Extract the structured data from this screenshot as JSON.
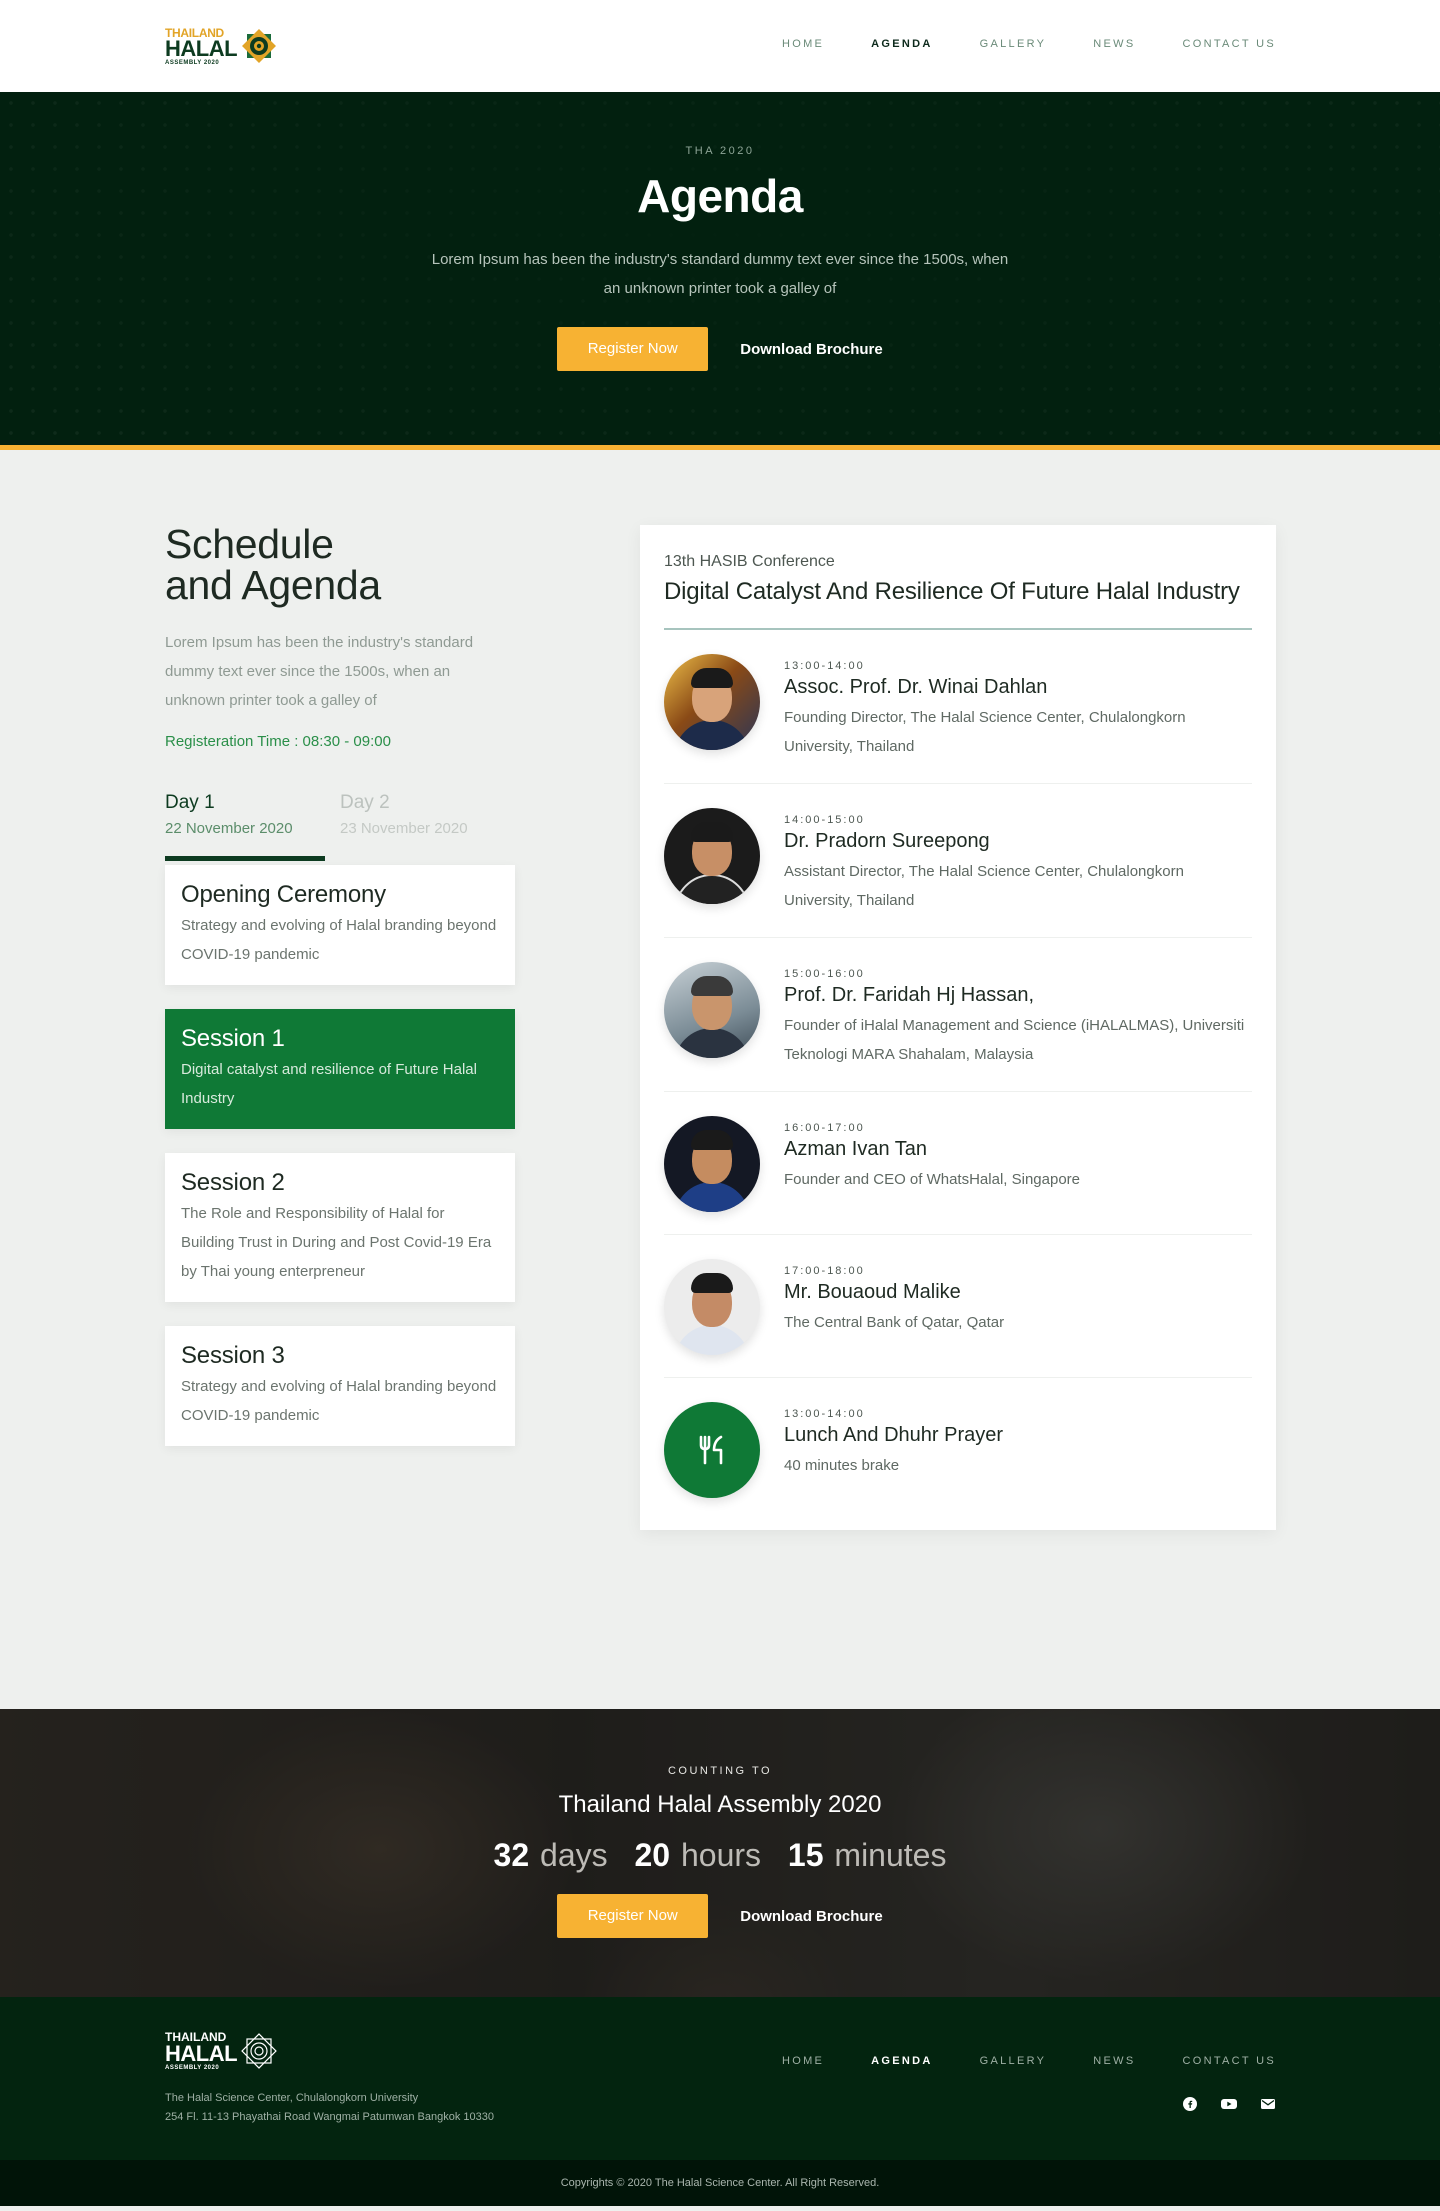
{
  "brand": {
    "line1": "THAILAND",
    "line2": "HALAL",
    "line3": "ASSEMBLY 2020"
  },
  "nav": [
    "HOME",
    "AGENDA",
    "GALLERY",
    "NEWS",
    "CONTACT US"
  ],
  "nav_active": "AGENDA",
  "hero": {
    "eyebrow": "THA 2020",
    "title": "Agenda",
    "text": "Lorem Ipsum has been the industry's standard dummy text ever since the 1500s, when an unknown printer took a galley of",
    "register": "Register Now",
    "brochure": "Download Brochure"
  },
  "schedule": {
    "title_line1": "Schedule",
    "title_line2": "and Agenda",
    "desc": "Lorem Ipsum has been the industry's standard dummy text ever since the 1500s, when an unknown printer took a galley of",
    "reg_time": "Registeration Time : 08:30 - 09:00",
    "days": [
      {
        "label": "Day 1",
        "date": "22 November 2020"
      },
      {
        "label": "Day 2",
        "date": "23 November 2020"
      }
    ],
    "sessions": [
      {
        "title": "Opening Ceremony",
        "desc": "Strategy and evolving of Halal  branding beyond COVID-19 pandemic"
      },
      {
        "title": "Session 1",
        "desc": "Digital catalyst and resilience of Future Halal Industry"
      },
      {
        "title": "Session 2",
        "desc": "The Role and Responsibility of Halal for Building Trust in During and Post Covid-19 Era by Thai young enterpreneur"
      },
      {
        "title": "Session 3",
        "desc": "Strategy and evolving of Halal  branding beyond COVID-19 pandemic"
      }
    ]
  },
  "card": {
    "subtitle": "13th HASIB Conference",
    "title": "Digital Catalyst And Resilience Of Future Halal Industry",
    "speakers": [
      {
        "time": "13:00-14:00",
        "name": "Assoc. Prof. Dr. Winai Dahlan",
        "role": "Founding Director, The Halal Science Center, Chulalongkorn University, Thailand"
      },
      {
        "time": "14:00-15:00",
        "name": "Dr. Pradorn Sureepong",
        "role": "Assistant Director, The Halal Science Center, Chulalongkorn University, Thailand"
      },
      {
        "time": "15:00-16:00",
        "name": "Prof. Dr. Faridah Hj Hassan,",
        "role": " Founder of iHalal Management and Science (iHALALMAS), Universiti Teknologi MARA Shahalam, Malaysia"
      },
      {
        "time": "16:00-17:00",
        "name": "Azman Ivan Tan",
        "role": "Founder and CEO of WhatsHalal, Singapore"
      },
      {
        "time": "17:00-18:00",
        "name": "Mr. Bouaoud Malike",
        "role": "The Central Bank of Qatar, Qatar"
      },
      {
        "time": "13:00-14:00",
        "name": "Lunch And Dhuhr Prayer",
        "role": "40 minutes brake"
      }
    ]
  },
  "countdown": {
    "eyebrow": "COUNTING TO",
    "title": "Thailand Halal Assembly 2020",
    "days": "32",
    "days_unit": "days",
    "hours": "20",
    "hours_unit": "hours",
    "minutes": "15",
    "minutes_unit": "minutes",
    "register": "Register Now",
    "brochure": "Download Brochure"
  },
  "footer": {
    "addr1": "The Halal Science Center, Chulalongkorn University",
    "addr2": "254 Fl. 11-13 Phayathai Road Wangmai Patumwan Bangkok 10330",
    "social": [
      "facebook-icon",
      "youtube-icon",
      "email-icon"
    ],
    "copyright": "Copyrights © 2020 The Halal Science Center. All Right Reserved."
  },
  "colors": {
    "dark_green": "#02200f",
    "accent_yellow": "#f7b233",
    "session_green": "#0f7936"
  }
}
